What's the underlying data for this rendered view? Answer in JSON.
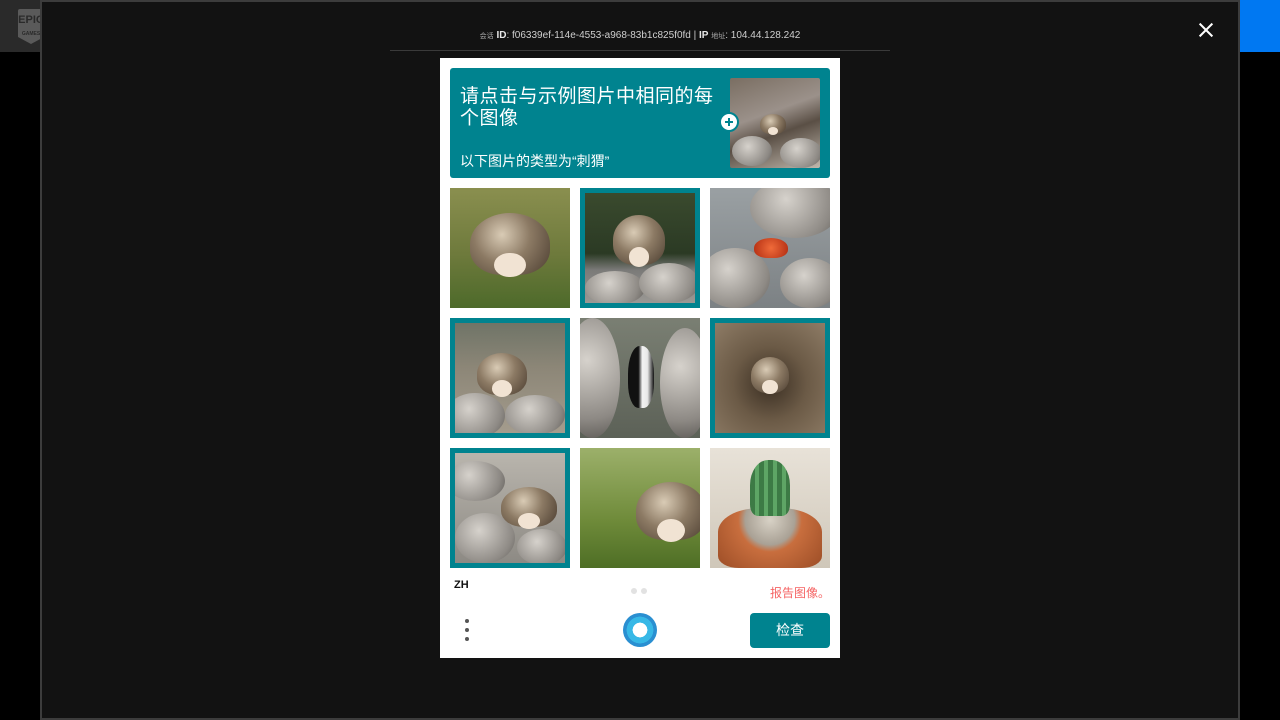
{
  "site": {
    "logo_text": "EPIC",
    "logo_sub": "GAMES"
  },
  "session": {
    "id_prefix": "会话",
    "id_label": "ID",
    "id_value": ": f06339ef-114e-4553-a968-83b1c825f0fd | ",
    "ip_label": "IP",
    "ip_prefix": "地址",
    "ip_value": ": 104.44.128.242"
  },
  "captcha": {
    "prompt_title": "请点击与示例图片中相同的每个图像",
    "prompt_subtitle": "以下图片的类型为“刺猬”",
    "example_image": "hedgehog-among-rocks",
    "tiles": [
      {
        "subject": "hedgehog on grass",
        "selected": false
      },
      {
        "subject": "hedgehog on rocks",
        "selected": true
      },
      {
        "subject": "crab on rocks",
        "selected": false
      },
      {
        "subject": "hedgehog on rocks",
        "selected": true
      },
      {
        "subject": "penguin on rocks",
        "selected": false
      },
      {
        "subject": "hedgehog in burrow",
        "selected": true
      },
      {
        "subject": "hedgehog on rocks",
        "selected": true
      },
      {
        "subject": "hedgehog in grass",
        "selected": false
      },
      {
        "subject": "cactus in pot",
        "selected": false
      }
    ],
    "language": "ZH",
    "report_label": "报告图像。",
    "submit_label": "检查",
    "accent_color": "#00838f"
  },
  "icons": {
    "close": "close-icon",
    "plus": "plus-icon",
    "menu": "menu-icon",
    "logo": "hcaptcha-logo-icon"
  }
}
